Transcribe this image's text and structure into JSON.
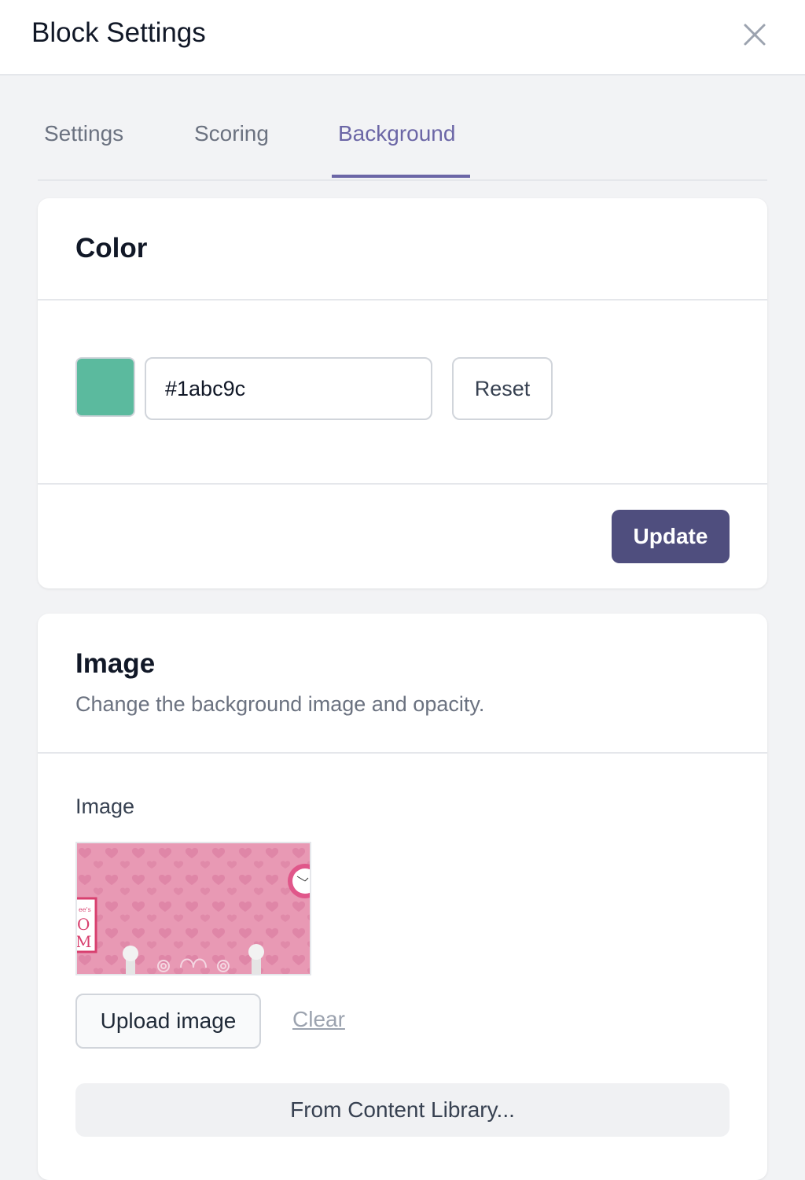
{
  "header": {
    "title": "Block Settings",
    "close_icon": "close-icon"
  },
  "tabs": [
    {
      "label": "Settings",
      "active": false
    },
    {
      "label": "Scoring",
      "active": false
    },
    {
      "label": "Background",
      "active": true
    }
  ],
  "color_card": {
    "title": "Color",
    "swatch_color": "#1abc9c",
    "hex_value": "#1abc9c",
    "reset_label": "Reset",
    "update_label": "Update"
  },
  "image_card": {
    "title": "Image",
    "subtitle": "Change the background image and opacity.",
    "field_label": "Image",
    "thumbnail_alt": "Pink hearts wallpaper room background",
    "upload_label": "Upload image",
    "clear_label": "Clear",
    "library_label": "From Content Library..."
  },
  "colors": {
    "accent": "#6b66a6",
    "primary_button": "#4f4e7e"
  }
}
